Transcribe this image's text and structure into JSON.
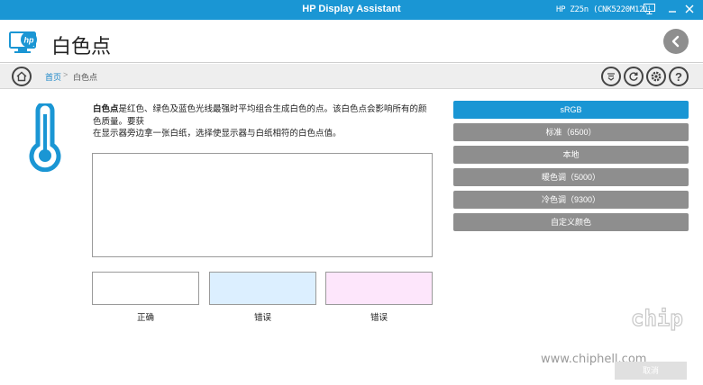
{
  "titlebar": {
    "app_title": "HP Display Assistant",
    "monitor_id": "HP Z25n (CNK5220M12)",
    "icon_one": "1",
    "minimize": "—",
    "close": "✕"
  },
  "header": {
    "logo_text": "hp",
    "page_title": "白色点"
  },
  "breadcrumb": {
    "home": "首页",
    "separator": ">",
    "current": "白色点"
  },
  "toolbar": {
    "icons": [
      "menu-circle-icon",
      "refresh-icon",
      "gear-icon",
      "help-icon"
    ],
    "help_glyph": "?"
  },
  "content": {
    "desc_bold": "白色点",
    "desc_rest": "是红色、绿色及蓝色光线最强时平均组合生成白色的点。该白色点会影响所有的颜色质量。要获",
    "desc_line2": "在显示器旁边拿一张白纸，选择使显示器与白纸相符的白色点值。",
    "samples": [
      {
        "label": "正确",
        "color": "#ffffff"
      },
      {
        "label": "错误",
        "color": "#dcefff"
      },
      {
        "label": "错误",
        "color": "#fde6fb"
      }
    ]
  },
  "options": [
    {
      "label": "sRGB",
      "selected": true
    },
    {
      "label": "标准（6500）",
      "selected": false
    },
    {
      "label": "本地",
      "selected": false
    },
    {
      "label": "暖色调（5000）",
      "selected": false
    },
    {
      "label": "冷色调（9300）",
      "selected": false
    },
    {
      "label": "自定义颜色",
      "selected": false
    }
  ],
  "footer": {
    "cancel_label": "取消"
  },
  "watermark": {
    "text": "www.chiphell.com",
    "logo_text": "chip hell"
  },
  "colors": {
    "accent": "#1a96d4",
    "button_gray": "#8e8e8e",
    "thermo_blue": "#1a96d4"
  }
}
